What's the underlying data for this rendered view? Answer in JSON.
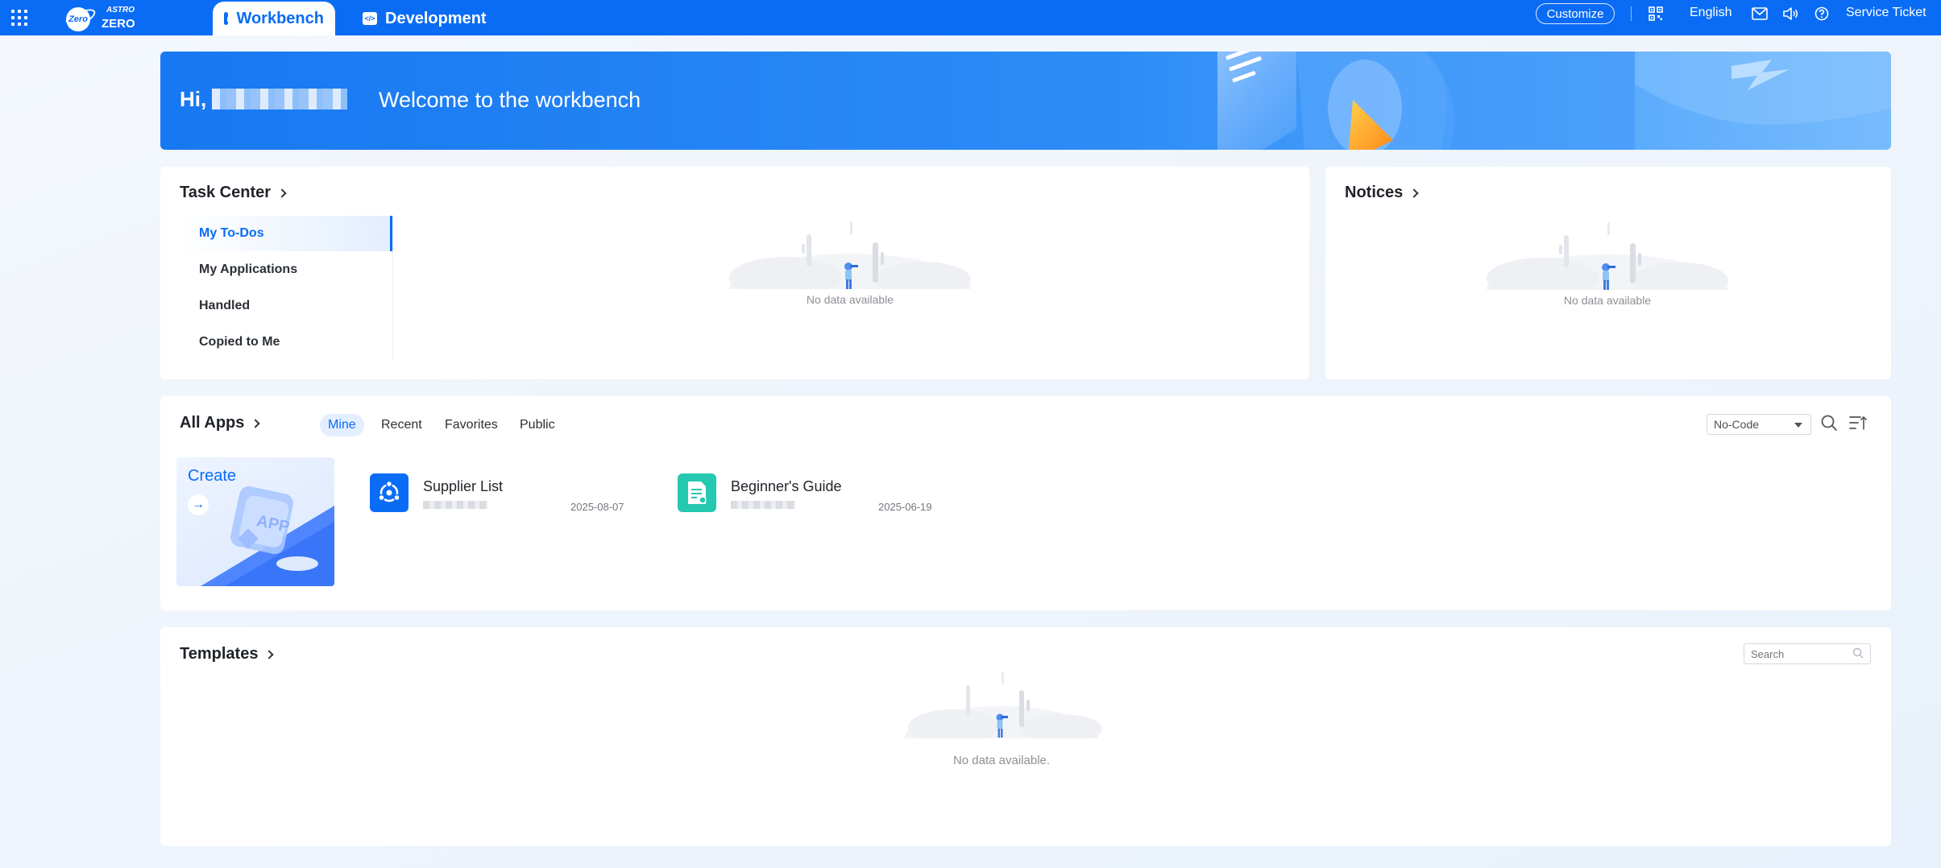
{
  "topbar": {
    "logo_top": "ASTRO",
    "logo_bottom": "ZERO",
    "logo_badge": "Zero",
    "tabs": [
      {
        "label": "Workbench",
        "active": true
      },
      {
        "label": "Development",
        "active": false
      }
    ],
    "customize_label": "Customize",
    "language": "English",
    "service_ticket": "Service Ticket",
    "icons": [
      "apps-grid-icon",
      "qr-code-icon",
      "mail-icon",
      "speaker-icon",
      "help-icon"
    ],
    "accent_color": "#0a6cf5"
  },
  "banner": {
    "greeting": "Hi,",
    "welcome": "Welcome to the workbench"
  },
  "task_center": {
    "title": "Task Center",
    "menu": [
      {
        "label": "My To-Dos",
        "active": true
      },
      {
        "label": "My Applications",
        "active": false
      },
      {
        "label": "Handled",
        "active": false
      },
      {
        "label": "Copied to Me",
        "active": false
      }
    ],
    "empty_text": "No data available"
  },
  "notices": {
    "title": "Notices",
    "empty_text": "No data available"
  },
  "all_apps": {
    "title": "All Apps",
    "filters": [
      {
        "label": "Mine",
        "active": true
      },
      {
        "label": "Recent",
        "active": false
      },
      {
        "label": "Favorites",
        "active": false
      },
      {
        "label": "Public",
        "active": false
      }
    ],
    "type_select": "No-Code",
    "create_label": "Create",
    "apps": [
      {
        "name": "Supplier List",
        "date": "2025-08-07",
        "icon": "supplier-app-icon",
        "color": "#0a6cf5"
      },
      {
        "name": "Beginner's Guide",
        "date": "2025-06-19",
        "icon": "guide-app-icon",
        "color": "#25c8b0"
      }
    ]
  },
  "templates": {
    "title": "Templates",
    "search_placeholder": "Search",
    "empty_text": "No data available."
  }
}
